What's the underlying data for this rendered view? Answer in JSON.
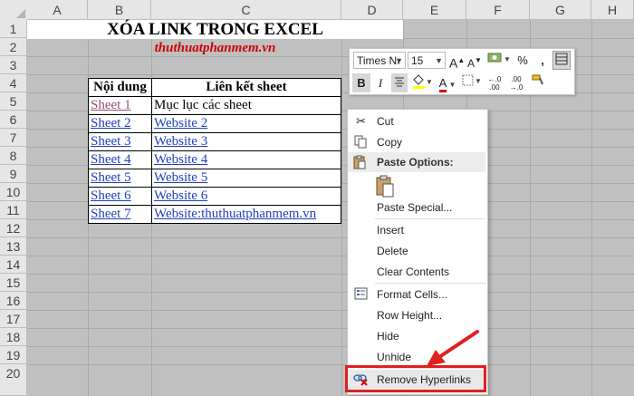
{
  "columns": [
    "A",
    "B",
    "C",
    "D",
    "E",
    "F",
    "G",
    "H"
  ],
  "rows": [
    "1",
    "2",
    "3",
    "4",
    "5",
    "6",
    "7",
    "8",
    "9",
    "10",
    "11",
    "12",
    "13",
    "14",
    "15",
    "16",
    "17",
    "18",
    "19",
    "20"
  ],
  "sheet": {
    "title": "XÓA LINK TRONG EXCEL",
    "subtitle": "thuthuatphanmem.vn",
    "table_headers": [
      "Nội dung",
      "Liên kết sheet"
    ],
    "table_rows": [
      [
        "Sheet 1",
        "Mục lục các sheet"
      ],
      [
        "Sheet 2",
        "Website 2"
      ],
      [
        "Sheet 3",
        "Website 3"
      ],
      [
        "Sheet 4",
        "Website 4"
      ],
      [
        "Sheet 5",
        "Website 5"
      ],
      [
        "Sheet 6",
        "Website 6"
      ],
      [
        "Sheet 7",
        "Website:thuthuatphanmem.vn"
      ]
    ]
  },
  "mini_toolbar": {
    "font_name": "Times Nı",
    "font_size": "15",
    "grow": "A",
    "shrink": "A",
    "percent": "%",
    "comma": ",",
    "bold": "B",
    "italic": "I",
    "font_color_letter": "A",
    "inc_decimal": "←.0\n.00",
    "dec_decimal": ".00\n→.0"
  },
  "context_menu": {
    "cut": "Cut",
    "copy": "Copy",
    "paste_options": "Paste Options:",
    "paste_special": "Paste Special...",
    "insert": "Insert",
    "delete": "Delete",
    "clear_contents": "Clear Contents",
    "format_cells": "Format Cells...",
    "row_height": "Row Height...",
    "hide": "Hide",
    "unhide": "Unhide",
    "remove_hyperlinks": "Remove Hyperlinks"
  },
  "colors": {
    "subtitle": "#d00000",
    "hyperlink": "#1f3fbf",
    "visited_link": "#954f72",
    "highlight_box": "#e02020",
    "arrow": "#e02020"
  }
}
